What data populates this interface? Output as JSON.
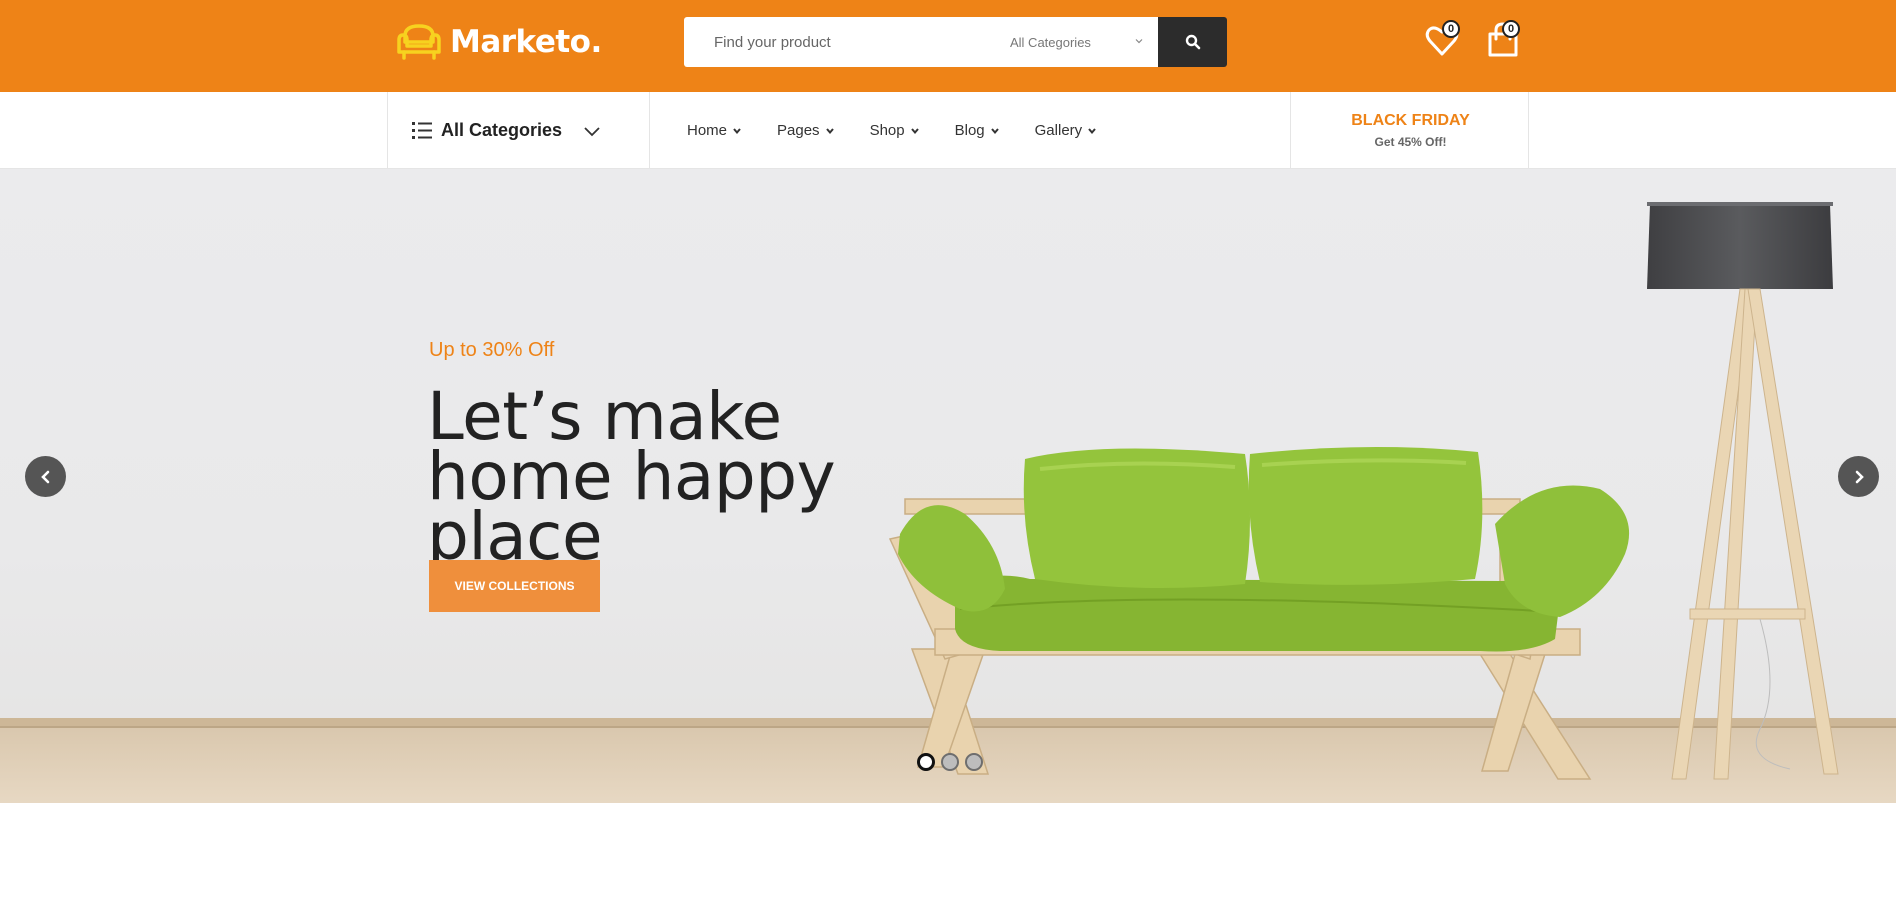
{
  "brand": {
    "name": "Marketo.",
    "logo_icon": "armchair-icon"
  },
  "search": {
    "placeholder": "Find your product",
    "category_selected": "All Categories",
    "button_icon": "search-icon"
  },
  "header_icons": {
    "wishlist": {
      "icon": "heart-icon",
      "count": "0"
    },
    "cart": {
      "icon": "shopping-bag-icon",
      "count": "0"
    }
  },
  "nav": {
    "categories_label": "All Categories",
    "menu": [
      {
        "label": "Home"
      },
      {
        "label": "Pages"
      },
      {
        "label": "Shop"
      },
      {
        "label": "Blog"
      },
      {
        "label": "Gallery"
      }
    ],
    "promo": {
      "title": "BLACK FRIDAY",
      "subtitle": "Get 45% Off!"
    }
  },
  "hero": {
    "kicker": "Up to 30% Off",
    "title": "Let’s make home happy place",
    "cta_label": "View Collections",
    "slides_total": 3,
    "active_slide": 1
  },
  "colors": {
    "brand_orange": "#ee8317",
    "cta_orange": "#ef8f3c",
    "dark": "#2c2c2c",
    "sofa_green": "#8fbf32"
  }
}
